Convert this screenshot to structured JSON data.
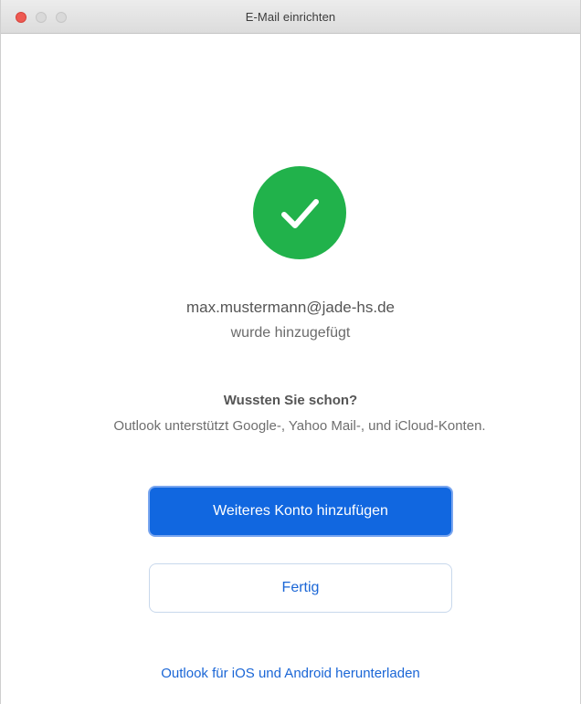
{
  "window": {
    "title": "E-Mail einrichten"
  },
  "success": {
    "icon": "checkmark-icon",
    "color": "#21b24b",
    "email": "max.mustermann@jade-hs.de",
    "message": "wurde hinzugefügt"
  },
  "tip": {
    "title": "Wussten Sie schon?",
    "text": "Outlook unterstützt Google-, Yahoo Mail-, und iCloud-Konten."
  },
  "actions": {
    "add_account_label": "Weiteres Konto hinzufügen",
    "done_label": "Fertig",
    "download_link": "Outlook für iOS und Android herunterladen"
  },
  "colors": {
    "accent": "#1167e0",
    "link": "#1a66d6"
  }
}
